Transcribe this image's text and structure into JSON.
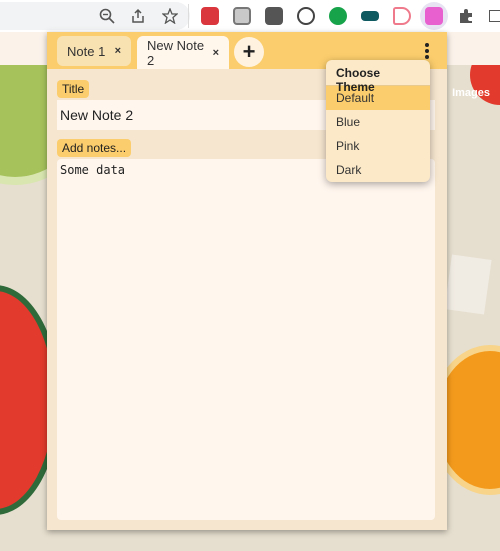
{
  "browser": {
    "icons": [
      "zoom-icon",
      "share-icon",
      "star-icon",
      "pin-extension-icon",
      "gallery-extension-icon",
      "extension-3-icon",
      "code-extension-icon",
      "cart-extension-icon",
      "tag-extension-icon",
      "arrow-extension-icon",
      "notes-extension-icon",
      "puzzle-icon",
      "window-icon"
    ]
  },
  "background": {
    "images_label": "Images"
  },
  "notes": {
    "tabs": [
      {
        "label": "Note 1",
        "close": "×"
      },
      {
        "label": "New Note 2",
        "close": "×"
      }
    ],
    "add_label": "+",
    "title_label": "Title",
    "title_value": "New Note 2",
    "notes_label": "Add notes...",
    "notes_value": "Some data"
  },
  "theme_menu": {
    "heading": "Choose Theme",
    "options": [
      "Default",
      "Blue",
      "Pink",
      "Dark"
    ],
    "selected": "Default"
  },
  "colors": {
    "accent": "#fbcd6c",
    "panel": "#f6e6cf",
    "field": "#fff6ee"
  }
}
